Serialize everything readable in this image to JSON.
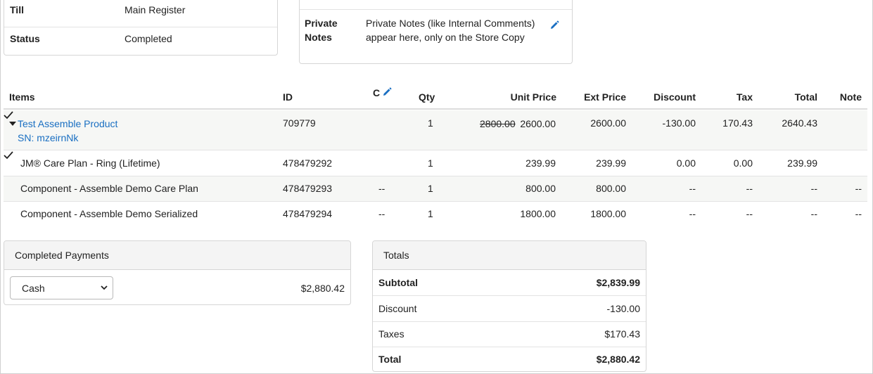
{
  "sale_info": {
    "till_label": "Till",
    "till_value": "Main Register",
    "status_label": "Status",
    "status_value": "Completed"
  },
  "private_notes": {
    "label": "Private Notes",
    "text": "Private Notes (like Internal Comments) appear here, only on the Store Copy",
    "edit_icon": "pencil-icon"
  },
  "items_table": {
    "headers": {
      "items": "Items",
      "id": "ID",
      "c": "C",
      "qty": "Qty",
      "unit_price": "Unit Price",
      "ext_price": "Ext Price",
      "discount": "Discount",
      "tax": "Tax",
      "total": "Total",
      "note": "Note"
    },
    "rows": [
      {
        "name": "Test Assemble Product",
        "serial": "SN: mzeirnNk",
        "id": "709779",
        "c": "check",
        "qty": "1",
        "original_price": "2800.00",
        "unit_price": "2600.00",
        "ext_price": "2600.00",
        "discount": "-130.00",
        "tax": "170.43",
        "total": "2640.43",
        "note": ""
      },
      {
        "name": "JM® Care Plan - Ring (Lifetime)",
        "id": "478479292",
        "c": "check",
        "qty": "1",
        "unit_price": "239.99",
        "ext_price": "239.99",
        "discount": "0.00",
        "tax": "0.00",
        "total": "239.99",
        "note": ""
      },
      {
        "name": "Component - Assemble Demo Care Plan",
        "id": "478479293",
        "c": "--",
        "qty": "1",
        "unit_price": "800.00",
        "ext_price": "800.00",
        "discount": "--",
        "tax": "--",
        "total": "--",
        "note": "--"
      },
      {
        "name": "Component - Assemble Demo Serialized",
        "id": "478479294",
        "c": "--",
        "qty": "1",
        "unit_price": "1800.00",
        "ext_price": "1800.00",
        "discount": "--",
        "tax": "--",
        "total": "--",
        "note": "--"
      }
    ]
  },
  "completed_payments": {
    "title": "Completed Payments",
    "method": "Cash",
    "amount": "$2,880.42"
  },
  "totals": {
    "title": "Totals",
    "subtotal_label": "Subtotal",
    "subtotal_value": "$2,839.99",
    "discount_label": "Discount",
    "discount_value": "-130.00",
    "taxes_label": "Taxes",
    "taxes_value": "$170.43",
    "total_label": "Total",
    "total_value": "$2,880.42"
  },
  "colors": {
    "link": "#1a6fc2",
    "row_alt_bg": "#f6f7f5",
    "panel_head_bg": "#f4f4f4"
  }
}
